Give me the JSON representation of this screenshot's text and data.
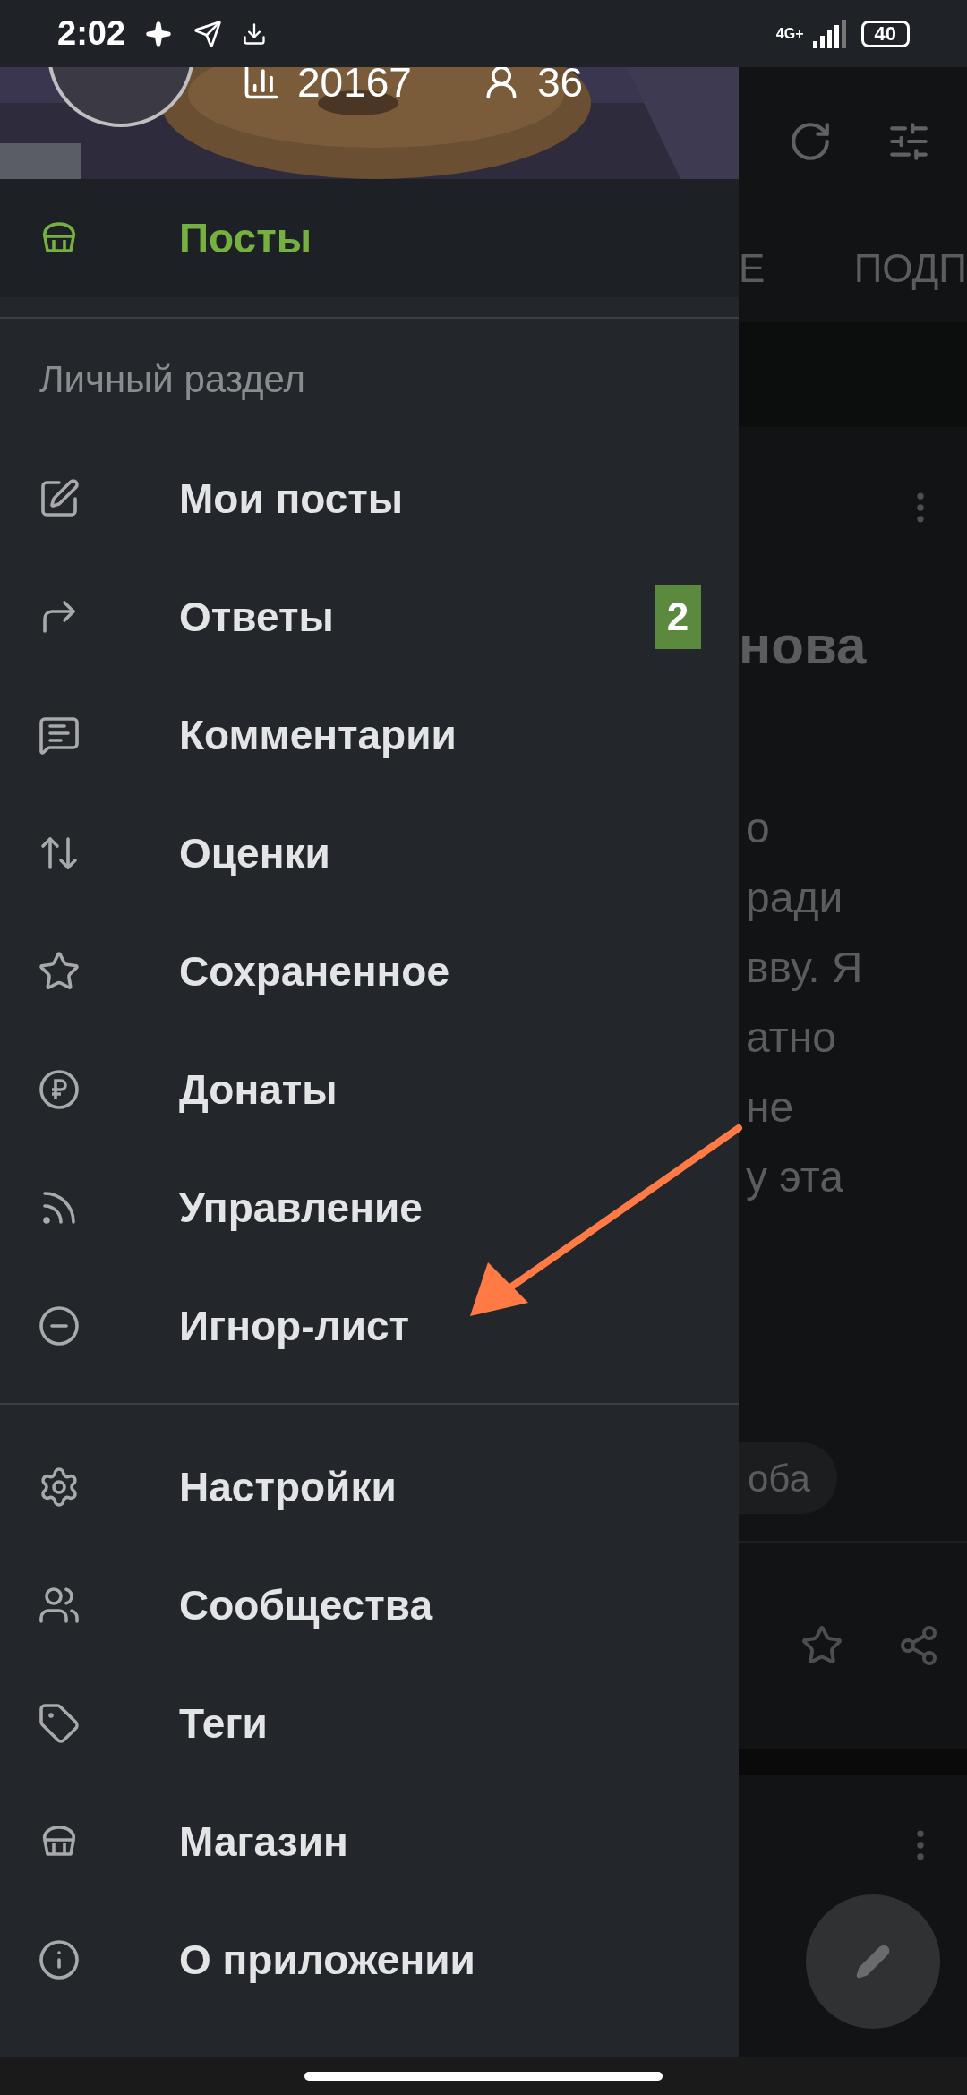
{
  "status_bar": {
    "time": "2:02",
    "network": "4G+",
    "battery": "40"
  },
  "header": {
    "stats": [
      "20167",
      "36"
    ]
  },
  "drawer": {
    "top_item": {
      "label": "Посты",
      "selected": true
    },
    "section_title": "Личный раздел",
    "personal_items": [
      {
        "label": "Мои посты",
        "selected": false
      },
      {
        "label": "Ответы",
        "selected": false,
        "badge": "2"
      },
      {
        "label": "Комментарии",
        "selected": false
      },
      {
        "label": "Оценки",
        "selected": false
      },
      {
        "label": "Сохраненное",
        "selected": false
      },
      {
        "label": "Донаты",
        "selected": false
      },
      {
        "label": "Управление",
        "selected": false
      },
      {
        "label": "Игнор-лист",
        "selected": false
      }
    ],
    "app_items": [
      {
        "label": "Настройки",
        "selected": false
      },
      {
        "label": "Сообщества",
        "selected": false
      },
      {
        "label": "Теги",
        "selected": false
      },
      {
        "label": "Магазин",
        "selected": false
      },
      {
        "label": "О приложении",
        "selected": false
      }
    ]
  },
  "background": {
    "tabs": [
      "Е",
      "ПОДП"
    ],
    "post_title": "нова",
    "body_lines": [
      "о",
      "ради",
      "вву. Я",
      "атно",
      "не",
      "у эта"
    ],
    "chip": "оба"
  }
}
